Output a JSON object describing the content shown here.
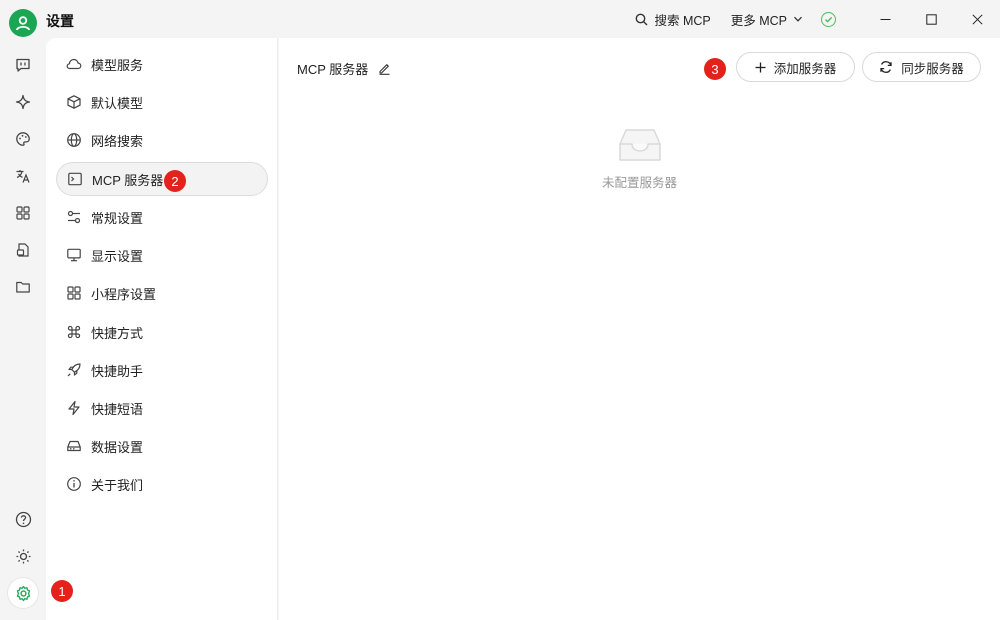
{
  "window": {
    "title": "设置",
    "search_mcp_label": "搜索 MCP",
    "more_mcp_label": "更多 MCP"
  },
  "rail": {
    "icons": [
      "chat-icon",
      "sparkle-icon",
      "palette-icon",
      "translate-icon",
      "apps-grid-icon",
      "files-icon",
      "folder-icon"
    ],
    "bottom_icons": [
      "help-icon",
      "brightness-icon",
      "settings-gear-icon"
    ]
  },
  "menu": {
    "items": [
      {
        "label": "模型服务",
        "icon": "cloud-icon"
      },
      {
        "label": "默认模型",
        "icon": "cube-icon"
      },
      {
        "label": "网络搜索",
        "icon": "globe-icon"
      },
      {
        "label": "MCP 服务器",
        "icon": "terminal-icon",
        "active": true
      },
      {
        "label": "常规设置",
        "icon": "sliders-icon"
      },
      {
        "label": "显示设置",
        "icon": "monitor-icon"
      },
      {
        "label": "小程序设置",
        "icon": "grid-icon"
      },
      {
        "label": "快捷方式",
        "icon": "command-icon"
      },
      {
        "label": "快捷助手",
        "icon": "rocket-icon"
      },
      {
        "label": "快捷短语",
        "icon": "bolt-icon"
      },
      {
        "label": "数据设置",
        "icon": "drive-icon"
      },
      {
        "label": "关于我们",
        "icon": "info-icon"
      }
    ]
  },
  "main": {
    "title": "MCP 服务器",
    "add_button": "添加服务器",
    "sync_button": "同步服务器",
    "empty_text": "未配置服务器"
  },
  "badges": [
    "1",
    "2",
    "3"
  ],
  "colors": {
    "accent": "#1ba653",
    "badge": "#e3221b",
    "status_ok": "#4cbb5b"
  }
}
